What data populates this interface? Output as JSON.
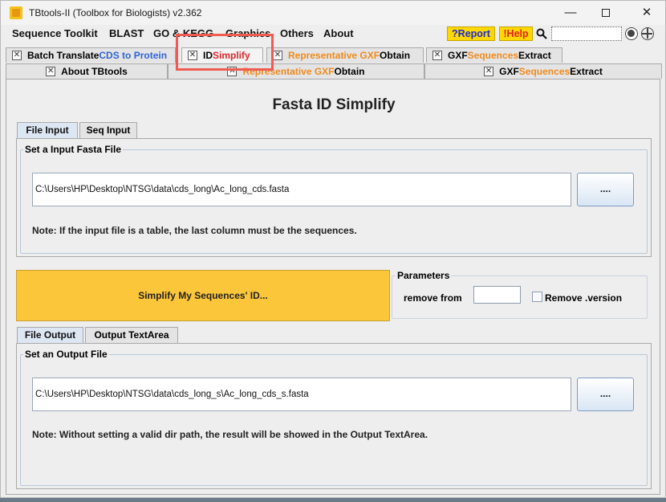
{
  "window": {
    "title": "TBtools-II (Toolbox for Biologists) v2.362",
    "minimize": "—",
    "close": "✕"
  },
  "menu": {
    "items": [
      "Sequence Toolkit",
      "BLAST",
      "GO & KEGG",
      "Graphics",
      "Others",
      "About"
    ],
    "report": "?Report",
    "help": "!Help"
  },
  "tabs_row1": [
    {
      "a": "Batch Translate ",
      "b": "CDS to Protein"
    },
    {
      "a": "ID ",
      "b": "Simplify"
    },
    {
      "a": "Representative GXF ",
      "b": "Obtain"
    },
    {
      "a": "GXF ",
      "b": "Sequences",
      "c": " Extract"
    }
  ],
  "tabs_row2": [
    {
      "a": "About TBtools"
    },
    {
      "a": "Representative GXF ",
      "b": "Obtain"
    },
    {
      "a": "GXF ",
      "b": "Sequences",
      "c": " Extract"
    }
  ],
  "panel": {
    "title": "Fasta ID Simplify",
    "input_tabs": [
      "File Input",
      "Seq Input"
    ],
    "input_group_label": "Set a Input Fasta File",
    "input_path": "C:\\Users\\HP\\Desktop\\NTSG\\data\\cds_long\\Ac_long_cds.fasta",
    "browse_label": "....",
    "input_note": "Note: If the input file is a table, the last column must be the sequences.",
    "run_label": "Simplify My Sequences' ID...",
    "params_label": "Parameters",
    "remove_from_label": "remove from",
    "remove_from_value": "",
    "remove_version_label": "Remove .version",
    "remove_version_checked": false,
    "output_tabs": [
      "File Output",
      "Output TextArea"
    ],
    "output_group_label": "Set an Output File",
    "output_path": "C:\\Users\\HP\\Desktop\\NTSG\\data\\cds_long_s\\Ac_long_cds_s.fasta",
    "output_note": "Note: Without setting a valid dir path, the result will be showed in the Output TextArea."
  },
  "colors": {
    "accent_yellow": "#fcc63a",
    "tab_blue": "#2f64d6",
    "tab_orange": "#f08a1c",
    "tab_red": "#e0282e",
    "highlight": "#ef5b50"
  }
}
